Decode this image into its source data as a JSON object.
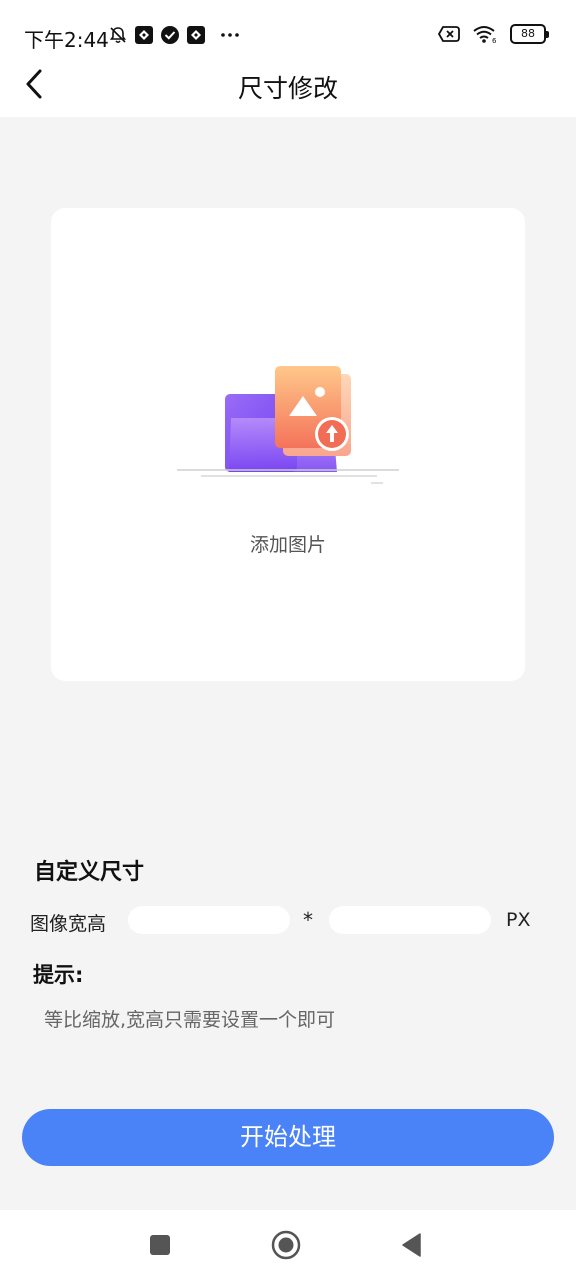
{
  "status_bar": {
    "time": "下午2:44",
    "left_icons": [
      "mute-bell-icon",
      "app-notification-icon",
      "check-circle-icon",
      "app-notification-icon",
      "more-dots-icon"
    ],
    "right_icons": [
      "sim-no-signal-icon",
      "wifi-icon"
    ],
    "battery": "88"
  },
  "nav": {
    "title": "尺寸修改",
    "back_icon": "chevron-left-icon"
  },
  "upload": {
    "label": "添加图片",
    "icon": "folder-image-upload-illustration"
  },
  "custom_size": {
    "title": "自定义尺寸",
    "dimension_label": "图像宽高",
    "width_value": "",
    "height_value": "",
    "separator": "*",
    "unit": "PX"
  },
  "hint": {
    "title": "提示:",
    "text": "等比缩放,宽高只需要设置一个即可"
  },
  "start_button": {
    "label": "开始处理",
    "color": "#4a82f7"
  },
  "system_nav": {
    "icons": [
      "recent-apps-square-icon",
      "home-circle-icon",
      "back-triangle-icon"
    ]
  }
}
